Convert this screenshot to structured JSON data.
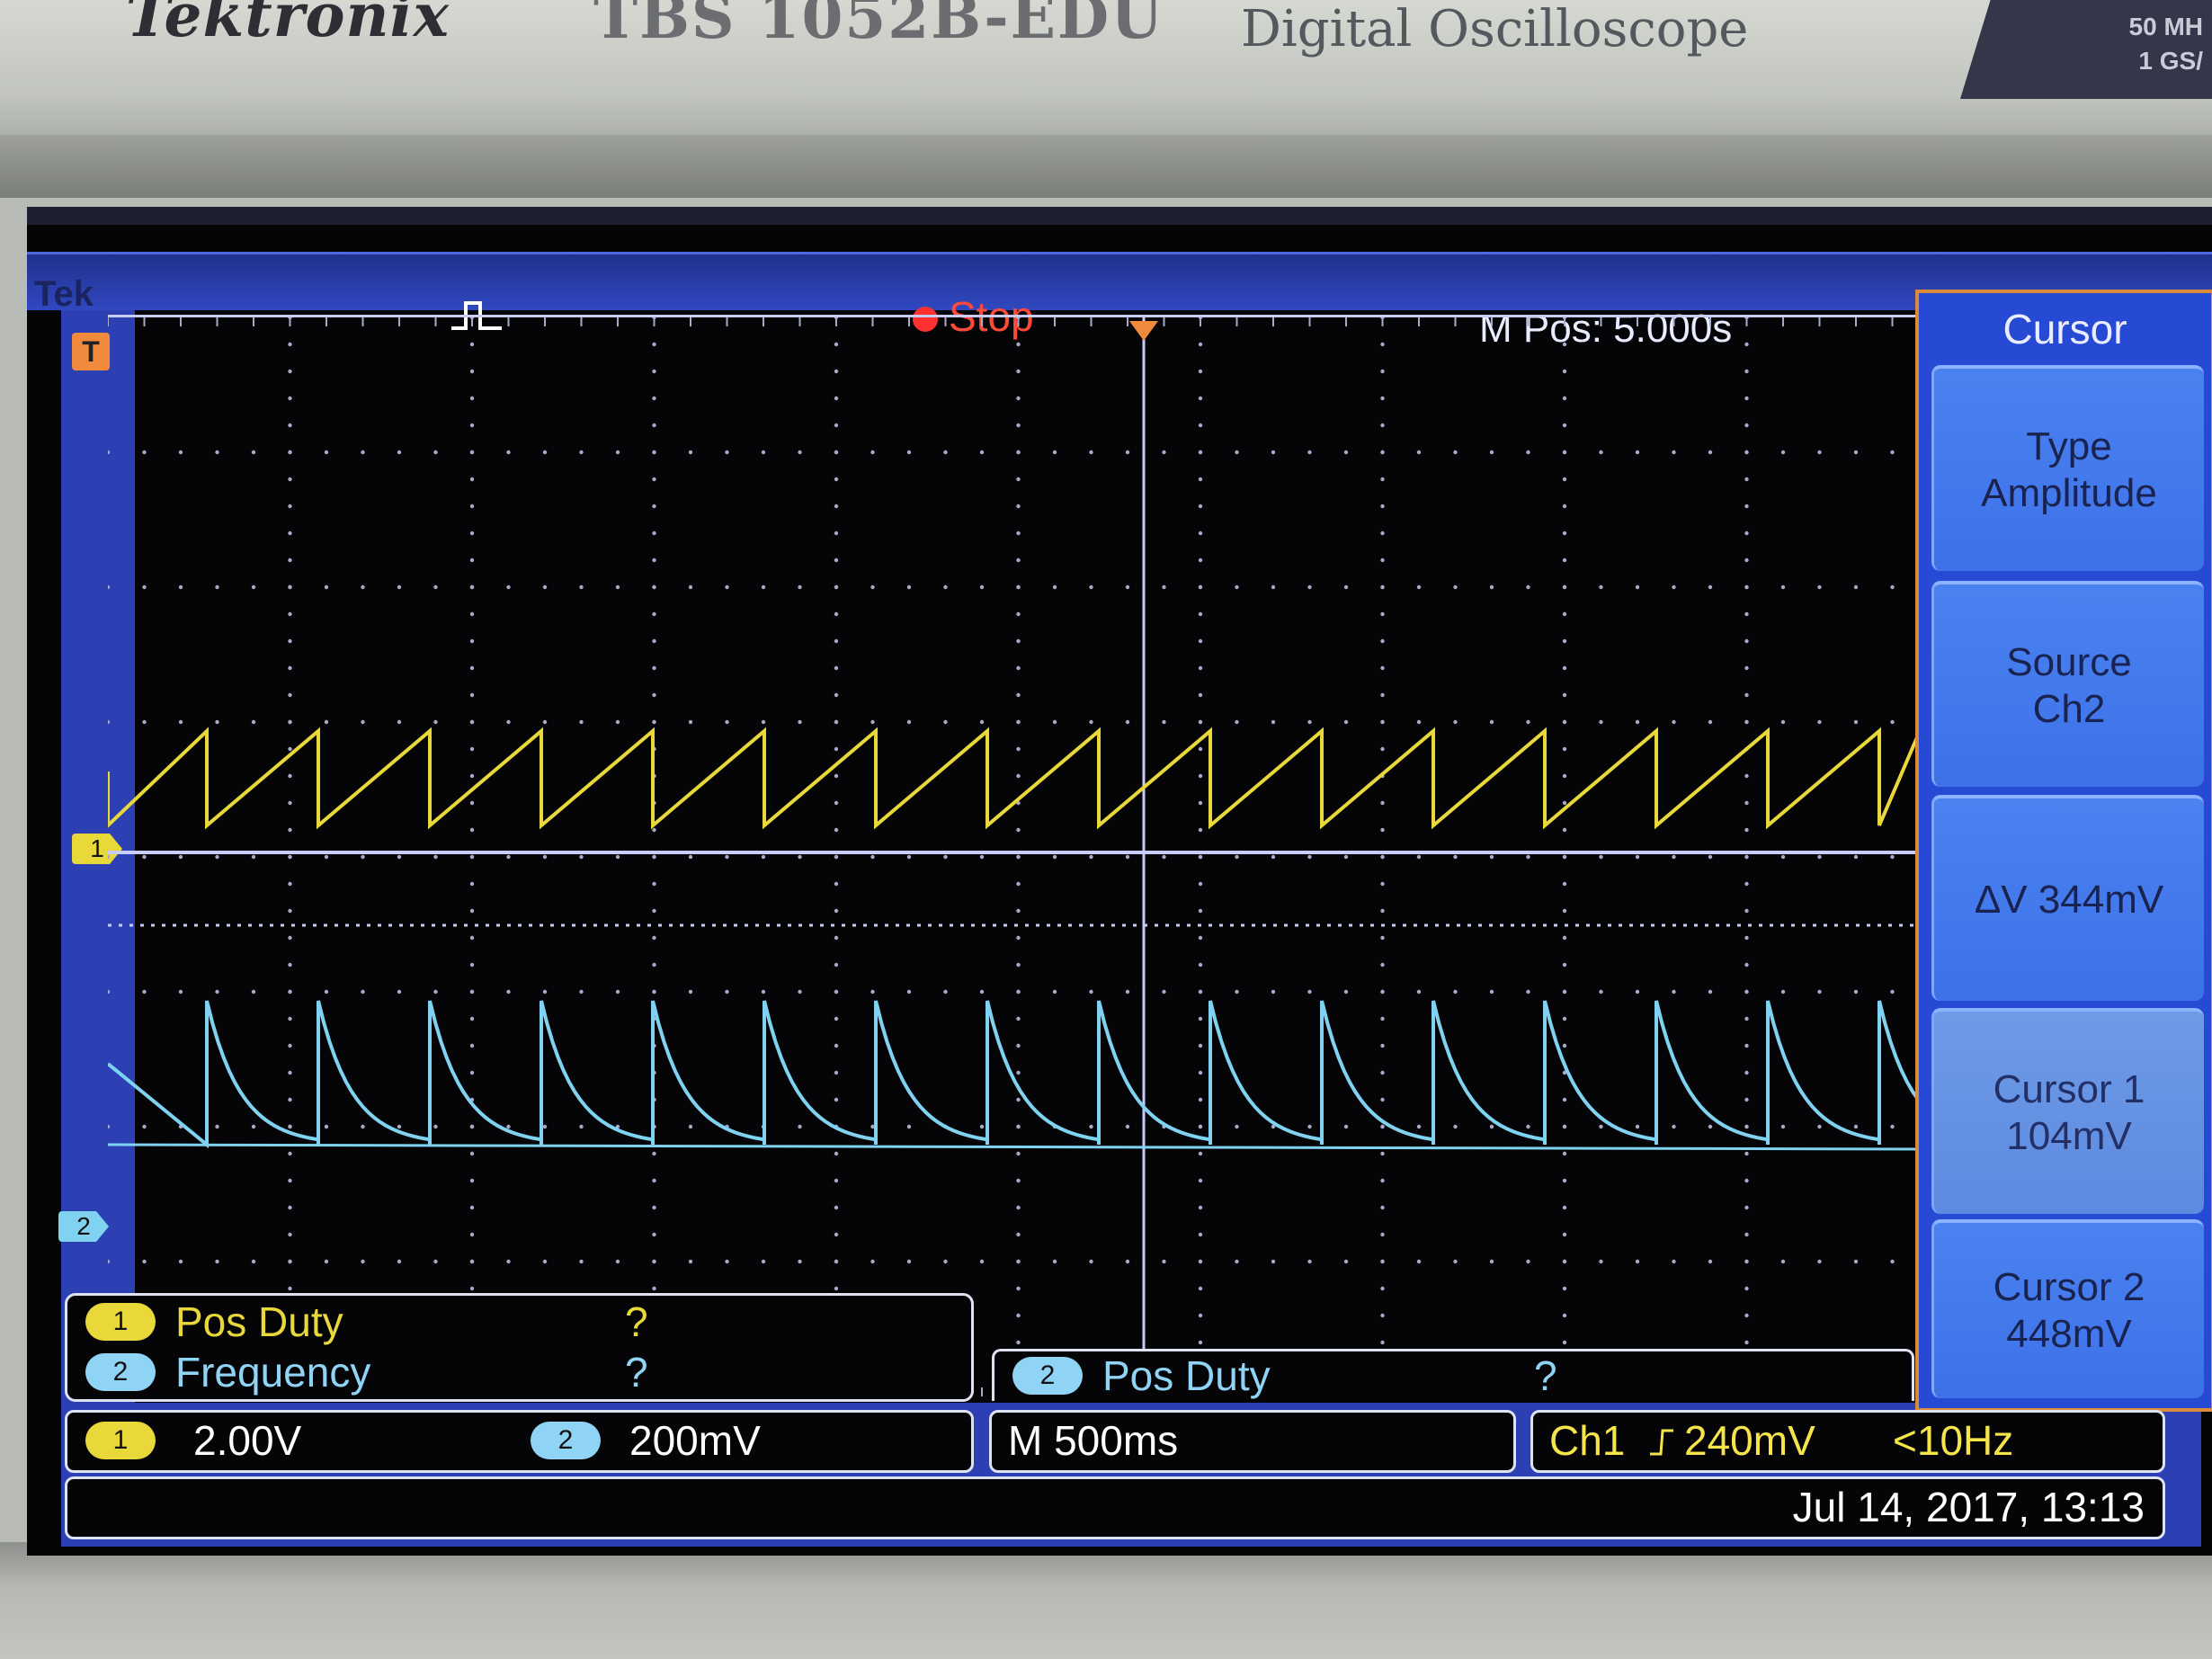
{
  "instrument": {
    "brand": "Tektronix",
    "model": "TBS 1052B-EDU",
    "description": "Digital Oscilloscope",
    "spec_bandwidth": "50 MH",
    "spec_sample_rate": "1 GS/"
  },
  "header": {
    "logo": "Tek",
    "acquisition_icon": "pulse-trigger-icon",
    "run_state": "Stop",
    "run_state_color": "#ff3030",
    "horizontal_position": "M Pos: 5.000s"
  },
  "markers": {
    "trigger": "T",
    "ch1": "1",
    "ch2": "2"
  },
  "side_menu": {
    "title": "Cursor",
    "buttons": [
      {
        "line1": "Type",
        "line2": "Amplitude"
      },
      {
        "line1": "Source",
        "line2": "Ch2"
      },
      {
        "line1": "ΔV 344mV",
        "line2": ""
      },
      {
        "line1": "Cursor 1",
        "line2": "104mV"
      },
      {
        "line1": "Cursor 2",
        "line2": "448mV"
      }
    ]
  },
  "measurements": {
    "left": [
      {
        "channel": "1",
        "label": "Pos Duty",
        "value": "?",
        "color": "#e8d83a"
      },
      {
        "channel": "2",
        "label": "Frequency",
        "value": "?",
        "color": "#8fd4f4"
      }
    ],
    "right": {
      "channel": "2",
      "label": "Pos Duty",
      "value": "?",
      "color": "#8fd4f4"
    }
  },
  "status": {
    "ch1_badge": "1",
    "ch1_scale": "2.00V",
    "ch2_badge": "2",
    "ch2_scale": "200mV",
    "timebase": "M 500ms",
    "trigger_source": "Ch1",
    "trigger_slope_icon": "rising-edge-icon",
    "trigger_level": "240mV",
    "trigger_freq": "<10Hz",
    "datetime": "Jul 14, 2017, 13:13"
  },
  "colors": {
    "ch1": "#e8d83a",
    "ch2": "#7fd3f0",
    "cursor_line": "#c8ccf8",
    "menu": "#274ad4",
    "screen_bg": "#050508"
  }
}
